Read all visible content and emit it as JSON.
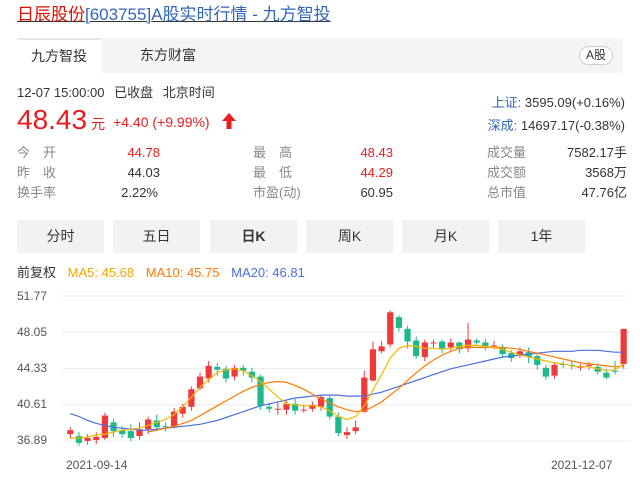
{
  "title": {
    "name": "日辰股份",
    "code": "[603755]",
    "rest": "A股实时行情 - 九方智投"
  },
  "tabs": {
    "active": "九方智投",
    "other": "东方财富",
    "badge": "A股"
  },
  "quote": {
    "time": "12-07 15:00:00",
    "status": "已收盘",
    "tz": "北京时间",
    "price": "48.43",
    "unit": "元",
    "change": "+4.40 (+9.99%)"
  },
  "indices": [
    {
      "name": "上证:",
      "value": "3595.09(+0.16%)"
    },
    {
      "name": "深成:",
      "value": "14697.17(-0.38%)"
    }
  ],
  "stats": [
    {
      "label": "今　开",
      "value": "44.78",
      "red": true
    },
    {
      "label": "最　高",
      "value": "48.43",
      "red": true
    },
    {
      "label": "成交量",
      "value": "7582.17手",
      "red": false
    },
    {
      "label": "昨　收",
      "value": "44.03",
      "red": false
    },
    {
      "label": "最　低",
      "value": "44.29",
      "red": true
    },
    {
      "label": "成交额",
      "value": "3568万",
      "red": false
    },
    {
      "label": "换手率",
      "value": "2.22%",
      "red": false
    },
    {
      "label": "市盈(动)",
      "value": "60.95",
      "red": false
    },
    {
      "label": "总市值",
      "value": "47.76亿",
      "red": false
    }
  ],
  "kline_buttons": [
    "分时",
    "五日",
    "日K",
    "周K",
    "月K",
    "1年"
  ],
  "active_kline": "日K",
  "ma": {
    "adjust": "前复权",
    "ma5": "MA5: 45.68",
    "ma10": "MA10: 45.75",
    "ma20": "MA20: 46.81"
  },
  "colors": {
    "up": "#f03a3a",
    "down": "#1db88b",
    "ma5": "#f5b800",
    "ma10": "#ff7a00",
    "ma20": "#4a6fe0",
    "red_text": "#e81e1e",
    "link": "#3366bb"
  },
  "chart_data": {
    "type": "candlestick",
    "yticks": [
      "51.77",
      "48.05",
      "44.33",
      "40.61",
      "36.89"
    ],
    "ylim": [
      36.89,
      51.77
    ],
    "x_start": "2021-09-14",
    "x_end": "2021-12-07",
    "candles": [
      [
        37.6,
        38.0,
        37.1,
        38.3
      ],
      [
        37.4,
        36.7,
        36.4,
        37.8
      ],
      [
        36.9,
        37.2,
        36.5,
        37.6
      ],
      [
        37.0,
        37.3,
        36.6,
        37.8
      ],
      [
        37.2,
        39.5,
        37.0,
        39.8
      ],
      [
        38.8,
        37.9,
        37.3,
        39.2
      ],
      [
        38.0,
        37.6,
        37.2,
        38.4
      ],
      [
        37.9,
        37.2,
        36.9,
        38.6
      ],
      [
        37.4,
        38.1,
        37.0,
        38.8
      ],
      [
        38.1,
        39.1,
        37.6,
        39.4
      ],
      [
        39.0,
        38.3,
        37.9,
        39.6
      ],
      [
        38.4,
        38.3,
        37.9,
        38.8
      ],
      [
        38.4,
        39.9,
        38.2,
        40.3
      ],
      [
        39.7,
        40.4,
        39.3,
        40.7
      ],
      [
        40.4,
        42.2,
        40.0,
        42.5
      ],
      [
        42.3,
        43.5,
        42.1,
        43.9
      ],
      [
        43.3,
        44.6,
        42.9,
        45.1
      ],
      [
        44.5,
        44.2,
        43.6,
        44.9
      ],
      [
        44.3,
        43.3,
        42.9,
        44.6
      ],
      [
        43.5,
        44.4,
        43.1,
        44.7
      ],
      [
        44.4,
        44.1,
        43.6,
        44.7
      ],
      [
        44.0,
        43.4,
        42.9,
        44.4
      ],
      [
        43.5,
        40.5,
        40.1,
        43.7
      ],
      [
        40.4,
        40.2,
        39.8,
        40.8
      ],
      [
        40.1,
        40.2,
        39.6,
        40.8
      ],
      [
        40.1,
        40.7,
        39.6,
        41.0
      ],
      [
        40.7,
        40.0,
        39.6,
        41.2
      ],
      [
        40.1,
        40.1,
        39.8,
        40.6
      ],
      [
        40.2,
        40.6,
        39.9,
        40.9
      ],
      [
        40.4,
        41.4,
        40.0,
        41.6
      ],
      [
        41.3,
        39.4,
        39.1,
        41.5
      ],
      [
        39.4,
        37.7,
        37.4,
        39.8
      ],
      [
        37.5,
        37.8,
        37.1,
        38.3
      ],
      [
        37.9,
        38.3,
        37.6,
        39.0
      ],
      [
        39.9,
        43.4,
        39.8,
        44.1
      ],
      [
        43.1,
        46.3,
        43.0,
        47.1
      ],
      [
        46.1,
        46.6,
        45.9,
        47.1
      ],
      [
        46.8,
        50.1,
        46.5,
        50.3
      ],
      [
        49.6,
        48.5,
        48.1,
        49.8
      ],
      [
        48.4,
        47.1,
        46.4,
        48.7
      ],
      [
        47.2,
        45.6,
        45.3,
        47.6
      ],
      [
        45.5,
        47.0,
        45.1,
        47.3
      ],
      [
        47.0,
        47.0,
        46.4,
        47.3
      ],
      [
        47.1,
        46.4,
        45.9,
        47.3
      ],
      [
        46.5,
        47.0,
        46.2,
        47.4
      ],
      [
        47.0,
        46.3,
        45.9,
        47.1
      ],
      [
        46.4,
        47.3,
        46.0,
        49.0
      ],
      [
        47.2,
        47.0,
        46.7,
        47.4
      ],
      [
        47.0,
        46.6,
        46.2,
        47.4
      ],
      [
        46.7,
        46.7,
        46.3,
        47.2
      ],
      [
        46.5,
        45.8,
        45.4,
        46.8
      ],
      [
        45.9,
        45.4,
        45.0,
        46.2
      ],
      [
        45.7,
        46.1,
        45.4,
        46.5
      ],
      [
        46.0,
        45.5,
        44.9,
        46.5
      ],
      [
        45.6,
        44.7,
        44.2,
        45.9
      ],
      [
        44.4,
        43.5,
        43.2,
        44.7
      ],
      [
        43.6,
        44.7,
        43.3,
        45.0
      ],
      [
        44.8,
        44.7,
        44.4,
        45.1
      ],
      [
        44.7,
        44.6,
        44.2,
        45.1
      ],
      [
        44.5,
        44.5,
        44.1,
        44.8
      ],
      [
        44.6,
        44.7,
        44.2,
        45.0
      ],
      [
        44.5,
        44.0,
        43.7,
        44.9
      ],
      [
        43.9,
        43.4,
        43.2,
        44.3
      ],
      [
        44.1,
        44.0,
        43.7,
        45.1
      ],
      [
        44.8,
        48.4,
        44.3,
        48.4
      ]
    ],
    "ma5": [
      37.2,
      37.2,
      37.3,
      37.5,
      37.6,
      37.8,
      38.0,
      38.1,
      38.2,
      38.5,
      38.8,
      39.1,
      39.6,
      40.4,
      41.4,
      42.4,
      43.2,
      43.9,
      44.2,
      44.3,
      44.1,
      43.6,
      43.0,
      42.2,
      41.4,
      40.7,
      40.6,
      40.5,
      40.5,
      40.4,
      40.0,
      39.4,
      39.1,
      39.4,
      40.5,
      42.1,
      43.7,
      45.4,
      46.4,
      46.7,
      46.6,
      46.4,
      46.4,
      46.3,
      46.4,
      46.6,
      46.7,
      46.7,
      46.6,
      46.5,
      46.3,
      46.0,
      45.7,
      45.5,
      45.3,
      45.1,
      44.9,
      44.8,
      44.6,
      44.5,
      44.5,
      44.3,
      44.1,
      44.2,
      44.8
    ],
    "ma10": [
      null,
      null,
      null,
      null,
      null,
      null,
      null,
      null,
      null,
      37.8,
      38.0,
      38.2,
      38.4,
      38.7,
      39.0,
      39.5,
      40.0,
      40.5,
      41.0,
      41.5,
      42.0,
      42.4,
      42.7,
      42.9,
      43.0,
      42.9,
      42.6,
      42.2,
      41.7,
      41.2,
      40.8,
      40.4,
      40.1,
      39.9,
      40.0,
      40.4,
      40.9,
      41.6,
      42.3,
      43.1,
      43.9,
      44.6,
      45.2,
      45.7,
      46.1,
      46.4,
      46.5,
      46.5,
      46.5,
      46.5,
      46.5,
      46.4,
      46.3,
      46.1,
      45.9,
      45.7,
      45.5,
      45.3,
      45.1,
      44.9,
      44.8,
      44.7,
      44.6,
      44.5,
      44.6
    ],
    "ma20": [
      39.7,
      39.4,
      39.0,
      38.7,
      38.5,
      38.3,
      38.2,
      38.1,
      38.0,
      38.0,
      38.1,
      38.2,
      38.3,
      38.4,
      38.5,
      38.6,
      38.8,
      39.0,
      39.3,
      39.6,
      39.9,
      40.2,
      40.5,
      40.7,
      40.9,
      41.1,
      41.3,
      41.4,
      41.5,
      41.6,
      41.6,
      41.6,
      41.5,
      41.5,
      41.5,
      41.7,
      41.9,
      42.2,
      42.5,
      42.8,
      43.1,
      43.4,
      43.7,
      44.0,
      44.3,
      44.5,
      44.7,
      44.9,
      45.1,
      45.3,
      45.5,
      45.6,
      45.7,
      45.8,
      45.9,
      46.0,
      46.1,
      46.1,
      46.1,
      46.2,
      46.2,
      46.2,
      46.1,
      46.0,
      46.0
    ]
  }
}
